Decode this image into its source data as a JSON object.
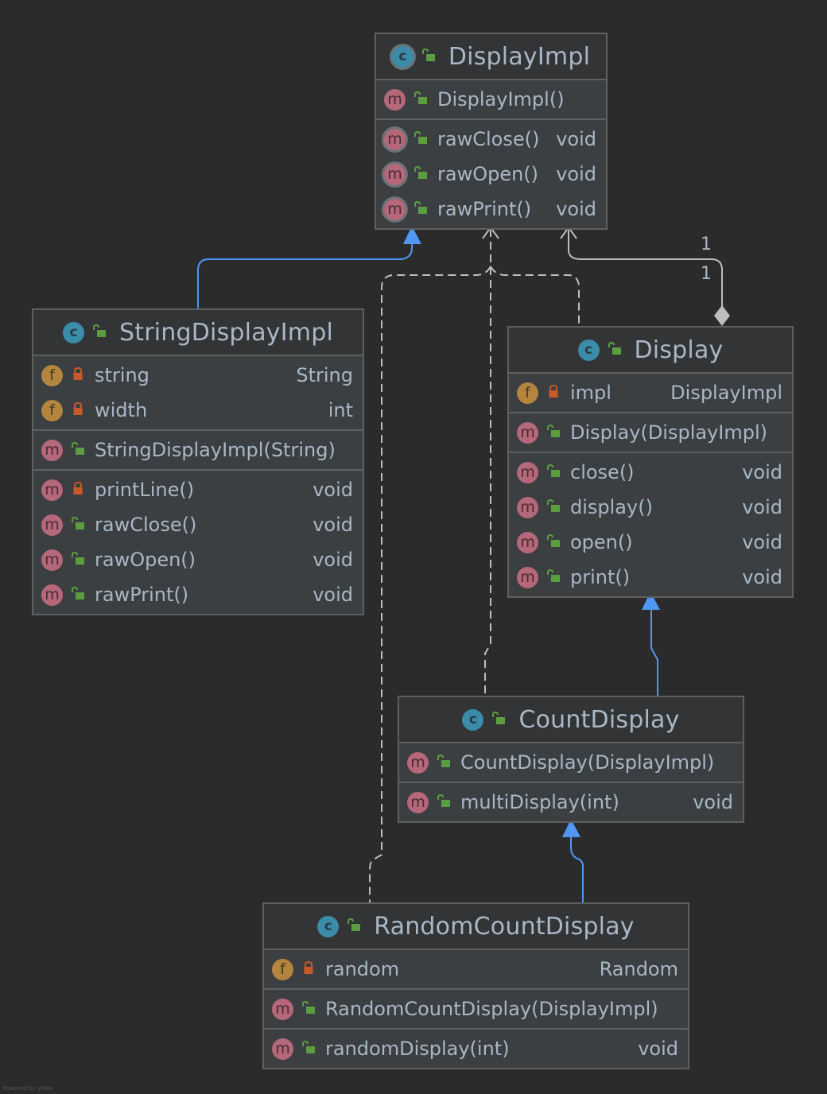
{
  "diagram": {
    "colors": {
      "background": "#2b2b2b",
      "node_fill": "#3c3f41",
      "node_header": "#333435",
      "node_border": "#5e6060",
      "text": "#a9b7c6",
      "class_badge": "#3a8ca8",
      "method_badge": "#b4687a",
      "field_badge": "#b3853f",
      "public_lock": "#5a9e3f",
      "private_lock": "#c9582a",
      "inheritance_edge": "#4f97f2",
      "dependency_edge": "#bdbdbd"
    },
    "classes": [
      {
        "id": "DisplayImpl",
        "name": "DisplayImpl",
        "kind": "abstract-class",
        "visibility": "public",
        "fields": [],
        "constructors": [
          {
            "name": "DisplayImpl()",
            "type": "",
            "visibility": "public",
            "abstract": false
          }
        ],
        "methods": [
          {
            "name": "rawClose()",
            "type": "void",
            "visibility": "public",
            "abstract": true
          },
          {
            "name": "rawOpen()",
            "type": "void",
            "visibility": "public",
            "abstract": true
          },
          {
            "name": "rawPrint()",
            "type": "void",
            "visibility": "public",
            "abstract": true
          }
        ]
      },
      {
        "id": "StringDisplayImpl",
        "name": "StringDisplayImpl",
        "kind": "class",
        "visibility": "public",
        "fields": [
          {
            "name": "string",
            "type": "String",
            "visibility": "private"
          },
          {
            "name": "width",
            "type": "int",
            "visibility": "private"
          }
        ],
        "constructors": [
          {
            "name": "StringDisplayImpl(String)",
            "type": "",
            "visibility": "public",
            "abstract": false
          }
        ],
        "methods": [
          {
            "name": "printLine()",
            "type": "void",
            "visibility": "private",
            "abstract": false
          },
          {
            "name": "rawClose()",
            "type": "void",
            "visibility": "public",
            "abstract": false
          },
          {
            "name": "rawOpen()",
            "type": "void",
            "visibility": "public",
            "abstract": false
          },
          {
            "name": "rawPrint()",
            "type": "void",
            "visibility": "public",
            "abstract": false
          }
        ]
      },
      {
        "id": "Display",
        "name": "Display",
        "kind": "class",
        "visibility": "public",
        "fields": [
          {
            "name": "impl",
            "type": "DisplayImpl",
            "visibility": "private"
          }
        ],
        "constructors": [
          {
            "name": "Display(DisplayImpl)",
            "type": "",
            "visibility": "public",
            "abstract": false
          }
        ],
        "methods": [
          {
            "name": "close()",
            "type": "void",
            "visibility": "public",
            "abstract": false
          },
          {
            "name": "display()",
            "type": "void",
            "visibility": "public",
            "abstract": false,
            "final": true
          },
          {
            "name": "open()",
            "type": "void",
            "visibility": "public",
            "abstract": false
          },
          {
            "name": "print()",
            "type": "void",
            "visibility": "public",
            "abstract": false
          }
        ]
      },
      {
        "id": "CountDisplay",
        "name": "CountDisplay",
        "kind": "class",
        "visibility": "public",
        "fields": [],
        "constructors": [
          {
            "name": "CountDisplay(DisplayImpl)",
            "type": "",
            "visibility": "public",
            "abstract": false
          }
        ],
        "methods": [
          {
            "name": "multiDisplay(int)",
            "type": "void",
            "visibility": "public",
            "abstract": false
          }
        ]
      },
      {
        "id": "RandomCountDisplay",
        "name": "RandomCountDisplay",
        "kind": "class",
        "visibility": "public",
        "fields": [
          {
            "name": "random",
            "type": "Random",
            "visibility": "private"
          }
        ],
        "constructors": [
          {
            "name": "RandomCountDisplay(DisplayImpl)",
            "type": "",
            "visibility": "public",
            "abstract": false
          }
        ],
        "methods": [
          {
            "name": "randomDisplay(int)",
            "type": "void",
            "visibility": "public",
            "abstract": false
          }
        ]
      }
    ],
    "relations": [
      {
        "from": "StringDisplayImpl",
        "to": "DisplayImpl",
        "type": "inheritance"
      },
      {
        "from": "Display",
        "to": "CountDisplay",
        "type": "inheritance",
        "direction": "CountDisplay extends Display"
      },
      {
        "from": "CountDisplay",
        "to": "RandomCountDisplay",
        "type": "inheritance",
        "direction": "RandomCountDisplay extends CountDisplay"
      },
      {
        "from": "Display",
        "to": "DisplayImpl",
        "type": "composition",
        "source_multiplicity": "1",
        "target_multiplicity": "1"
      },
      {
        "from": "Display",
        "to": "DisplayImpl",
        "type": "dependency"
      },
      {
        "from": "CountDisplay",
        "to": "DisplayImpl",
        "type": "dependency"
      },
      {
        "from": "RandomCountDisplay",
        "to": "DisplayImpl",
        "type": "dependency"
      }
    ],
    "multiplicity_labels": [
      "1",
      "1"
    ],
    "footer": "Powered by yFiles"
  }
}
